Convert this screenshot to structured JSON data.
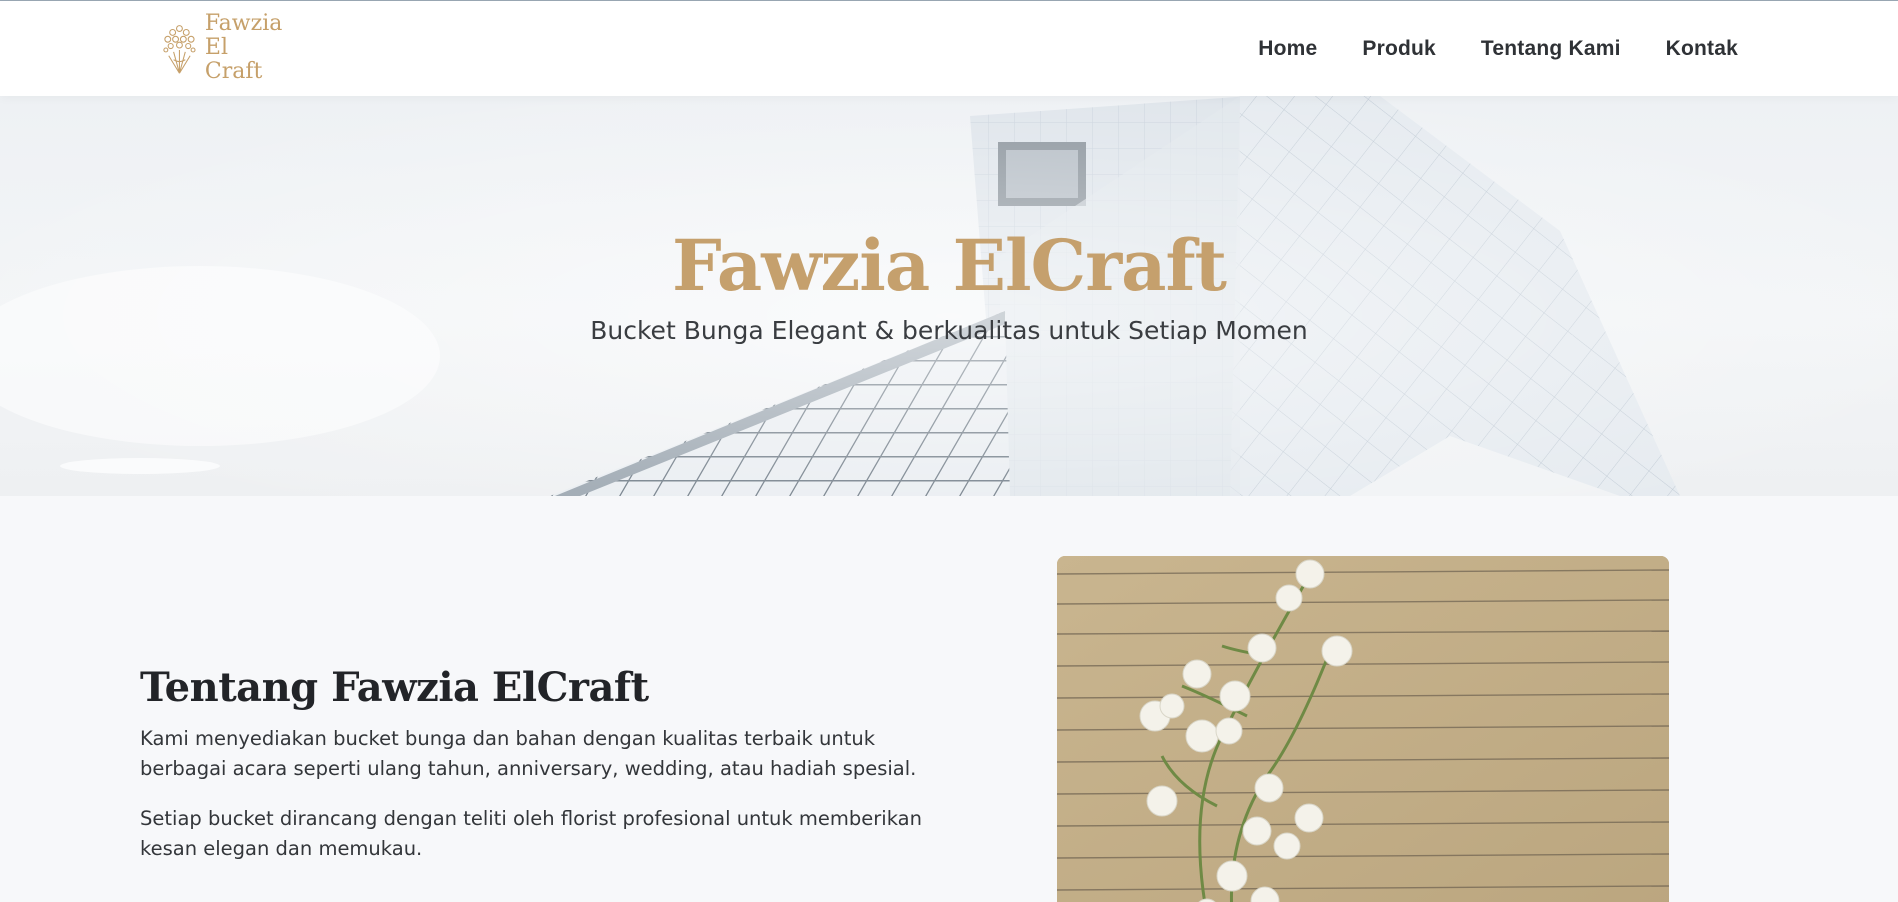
{
  "brand": {
    "logo_line1": "Fawzia",
    "logo_line2": "El Craft",
    "accent_color": "#c6a06a"
  },
  "nav": {
    "items": [
      {
        "label": "Home"
      },
      {
        "label": "Produk"
      },
      {
        "label": "Tentang Kami"
      },
      {
        "label": "Kontak"
      }
    ]
  },
  "hero": {
    "title": "Fawzia ElCraft",
    "subtitle": "Bucket Bunga Elegant & berkualitas untuk Setiap Momen",
    "background_icon": "building-photo"
  },
  "about": {
    "title": "Tentang Fawzia ElCraft",
    "paragraph1": "Kami menyediakan bucket bunga dan bahan dengan kualitas terbaik untuk berbagai acara seperti ulang tahun, anniversary, wedding, atau hadiah spesial.",
    "paragraph2": "Setiap bucket dirancang dengan teliti oleh florist profesional untuk memberikan kesan elegan dan memukau.",
    "image_icon": "lily-of-the-valley-photo"
  }
}
